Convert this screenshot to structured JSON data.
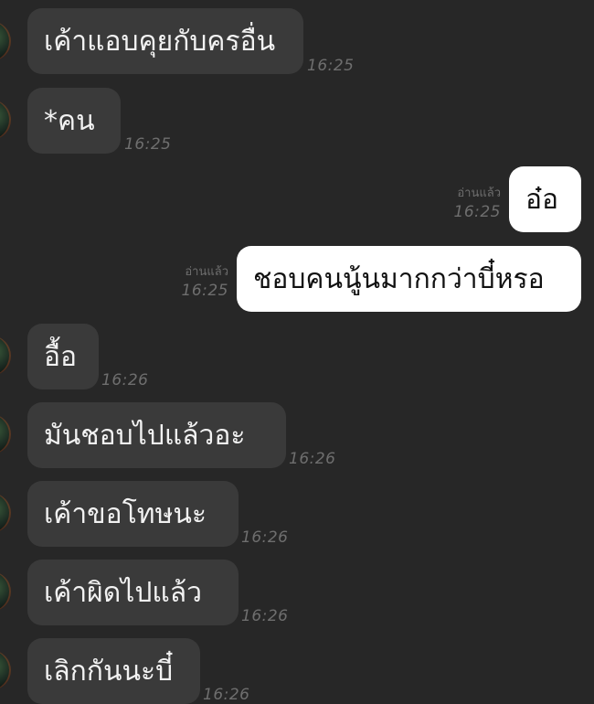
{
  "messages": [
    {
      "text": "เค้าแอบคุยกับครอื่น",
      "time": "16:25"
    },
    {
      "text": "*คน",
      "time": "16:25"
    },
    {
      "text": "อ๋อ",
      "time": "16:25",
      "read": "อ่านแล้ว"
    },
    {
      "text": "ชอบคนนู้นมากกว่าบี๋หรอ",
      "time": "16:25",
      "read": "อ่านแล้ว"
    },
    {
      "text": "อื้อ",
      "time": "16:26"
    },
    {
      "text": "มันชอบไปแล้วอะ",
      "time": "16:26"
    },
    {
      "text": "เค้าขอโทษนะ",
      "time": "16:26"
    },
    {
      "text": "เค้าผิดไปแล้ว",
      "time": "16:26"
    },
    {
      "text": "เลิกกันนะบี๋",
      "time": "16:26"
    }
  ]
}
